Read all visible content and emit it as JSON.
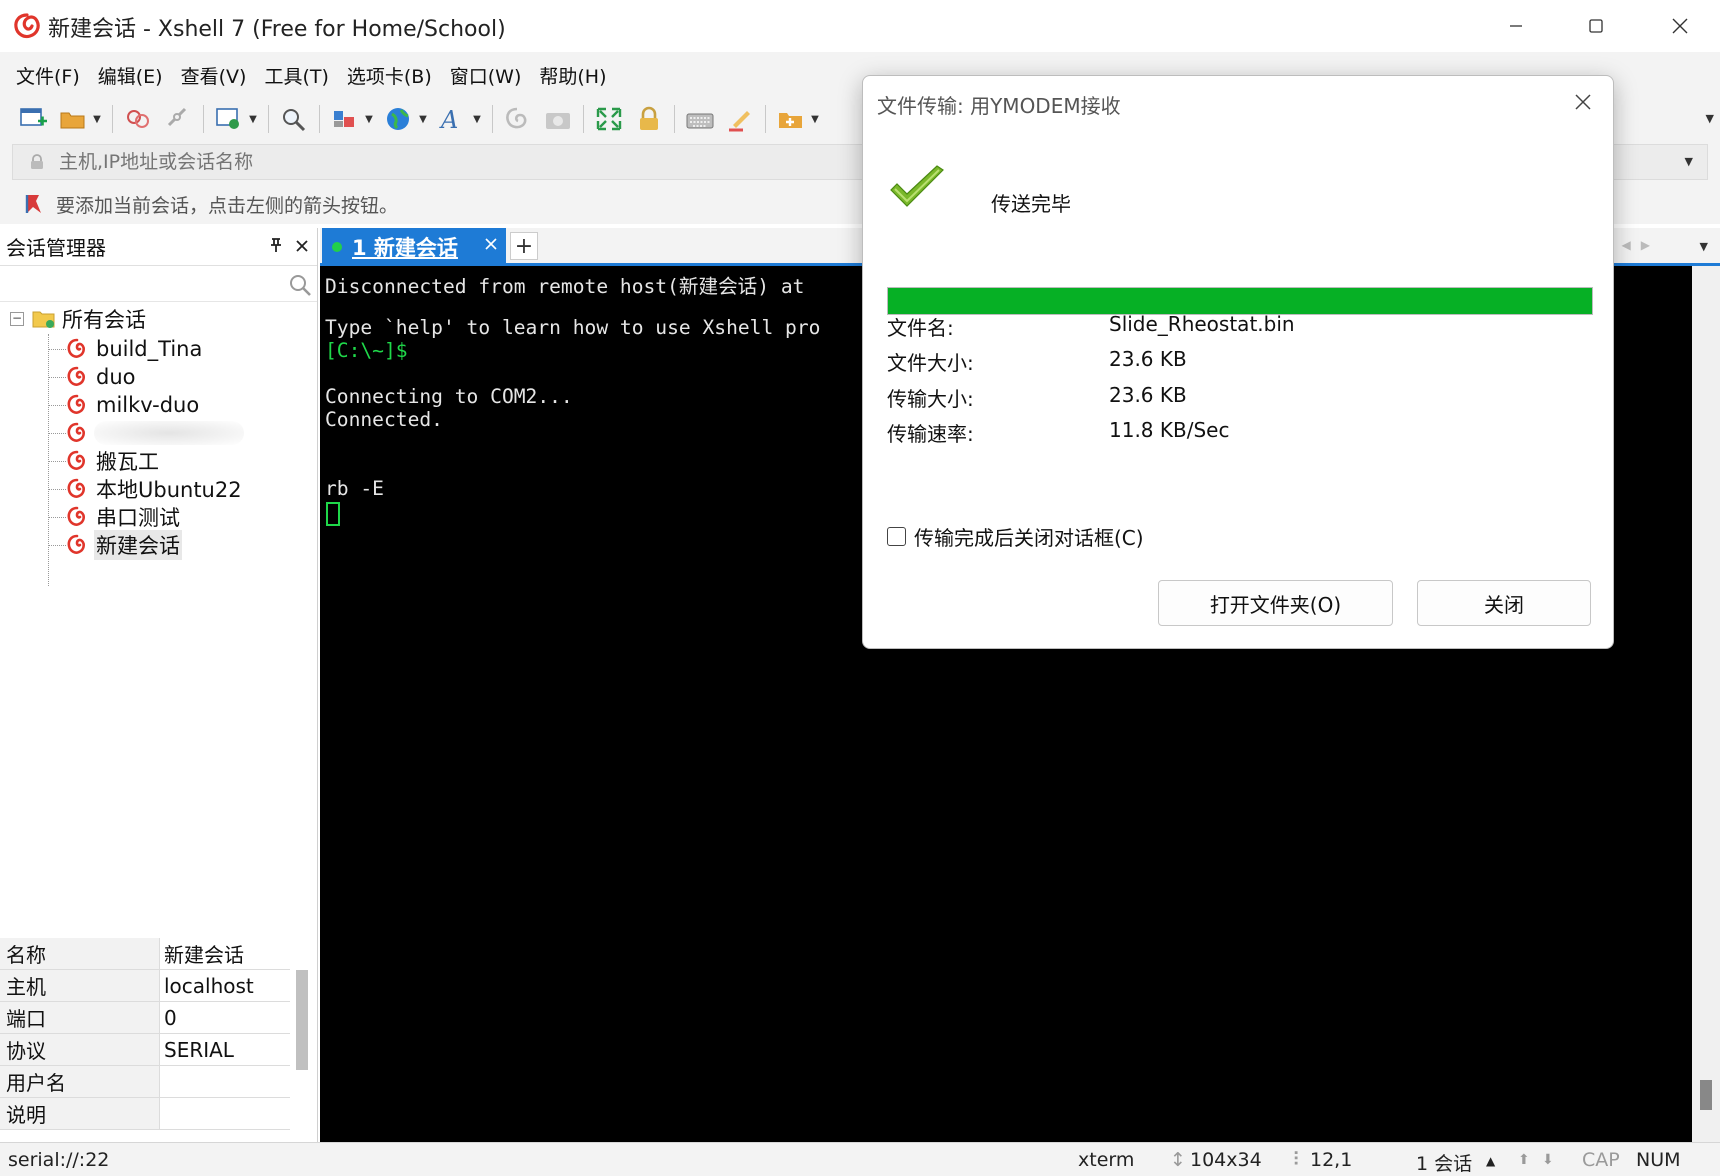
{
  "window": {
    "title": "新建会话 - Xshell 7 (Free for Home/School)"
  },
  "menu": [
    "文件(F)",
    "编辑(E)",
    "查看(V)",
    "工具(T)",
    "选项卡(B)",
    "窗口(W)",
    "帮助(H)"
  ],
  "toolbar": {
    "icons": [
      "new-session-icon",
      "open-folder-icon",
      "reconnect-icon",
      "disconnect-icon",
      "properties-icon",
      "find-icon",
      "layout-icon",
      "globe-icon",
      "font-icon",
      "transfer-icon",
      "camera-icon",
      "fullscreen-icon",
      "lock-icon",
      "keyboard-icon",
      "highlight-icon",
      "compose-icon"
    ]
  },
  "address": {
    "placeholder": "主机,IP地址或会话名称"
  },
  "links_bar": {
    "text": "要添加当前会话，点击左侧的箭头按钮。"
  },
  "session_manager": {
    "title": "会话管理器",
    "root": "所有会话",
    "items": [
      "build_Tina",
      "duo",
      "milkv-duo",
      "",
      "搬瓦工",
      "本地Ubuntu22",
      "串口测试",
      "新建会话"
    ],
    "selected": "新建会话",
    "properties": [
      {
        "key": "名称",
        "value": "新建会话"
      },
      {
        "key": "主机",
        "value": "localhost"
      },
      {
        "key": "端口",
        "value": "0"
      },
      {
        "key": "协议",
        "value": "SERIAL"
      },
      {
        "key": "用户名",
        "value": ""
      },
      {
        "key": "说明",
        "value": ""
      }
    ]
  },
  "tabs": {
    "active": "1 新建会话",
    "add": "+"
  },
  "terminal": {
    "lines": [
      "Disconnected from remote host(新建会话) at",
      "",
      "Type `help' to learn how to use Xshell pro",
      "[C:\\~]$",
      "",
      "Connecting to COM2...",
      "Connected.",
      "",
      "",
      "rb -E"
    ]
  },
  "status_bar": {
    "connection": "serial://:22",
    "terminal_type": "xterm",
    "size": "104x34",
    "cursor_pos": "12,1",
    "sessions": "1 会话",
    "cap": "CAP",
    "num": "NUM"
  },
  "dialog": {
    "title": "文件传输: 用YMODEM接收",
    "status": "传送完毕",
    "progress": 1.0,
    "fields": [
      {
        "label": "文件名:",
        "value": "Slide_Rheostat.bin"
      },
      {
        "label": "文件大小:",
        "value": "23.6 KB"
      },
      {
        "label": "传输大小:",
        "value": "23.6 KB"
      },
      {
        "label": "传输速率:",
        "value": "11.8 KB/Sec"
      }
    ],
    "checkbox_label": "传输完成后关闭对话框(C)",
    "checkbox_checked": false,
    "open_folder_button": "打开文件夹(O)",
    "close_button": "关闭"
  },
  "colors": {
    "accent": "#1e7bd6",
    "progress": "#06b025",
    "prompt": "#1fd84a",
    "terminal_bg": "#000000"
  }
}
